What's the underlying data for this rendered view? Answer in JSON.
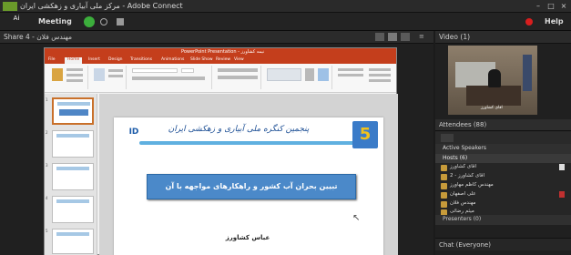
{
  "titlebar": {
    "title": "مرکز ملی آبیاری و زهکشی ایران - Adobe Connect",
    "minimize": "–",
    "maximize": "□",
    "close": "×"
  },
  "menubar": {
    "meeting_label": "Meeting",
    "help_label": "Help",
    "logo_text": "Ai"
  },
  "share_pod": {
    "title": "Share 4 - مهندس فلان"
  },
  "ppt": {
    "window_title": "PowerPoint Presentation - نیمه کشاورز",
    "tabs": [
      "File",
      "Home",
      "Insert",
      "Design",
      "Transitions",
      "Animations",
      "Slide Show",
      "Review",
      "View"
    ],
    "slide_numbers": [
      "1",
      "2",
      "3",
      "4",
      "5",
      "6",
      "7"
    ]
  },
  "slide": {
    "logo_text": "ID",
    "header_title": "پنجمین کنگره ملی آبیاری و زهکشی ایران",
    "emblem_number": "5",
    "main_title": "تبیین بحران آب کشور و راهکارهای مواجهه با آن",
    "author": "عباس کشاورز"
  },
  "video_pod": {
    "title": "Video (1)",
    "caption": "اقای کشاورز"
  },
  "attendees_pod": {
    "title": "Attendees (88)",
    "status": "Active Speakers",
    "group": "Hosts (6)",
    "hosts": [
      "اقای کشاورز",
      "اقای کشاورز - 2",
      "مهندس کاظم مهاورز",
      "علی اصفهان",
      "مهندس فلان",
      "میثم رضائی"
    ],
    "presenters_label": "Presenters (0)"
  },
  "chat_pod": {
    "title": "Chat (Everyone)"
  },
  "colors": {
    "ppt_accent": "#c43e1c",
    "slide_title_box": "#4b89c9",
    "recording": "#d81e1e"
  }
}
